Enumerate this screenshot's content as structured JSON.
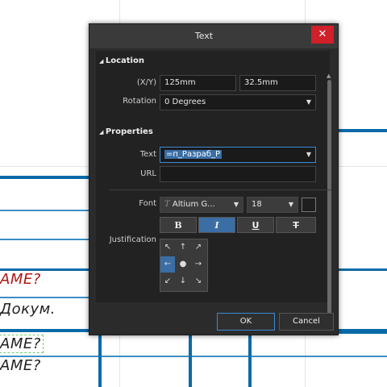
{
  "dialog": {
    "title": "Text",
    "close_icon": "close-icon"
  },
  "location": {
    "heading": "Location",
    "xy_label": "(X/Y)",
    "x_value": "125mm",
    "y_value": "32.5mm",
    "rotation_label": "Rotation",
    "rotation_value": "0 Degrees"
  },
  "properties": {
    "heading": "Properties",
    "text_label": "Text",
    "text_value": "=п_Разраб_Р",
    "url_label": "URL",
    "url_value": "",
    "font_label": "Font",
    "font_name": "Altium G...",
    "font_icon": "font-type-icon",
    "font_size": "18",
    "bold_label": "B",
    "italic_label": "I",
    "underline_label": "U",
    "strike_label": "T",
    "bold_active": false,
    "italic_active": true,
    "justification_label": "Justification",
    "justification_selected": "middle-left"
  },
  "buttons": {
    "ok": "OK",
    "cancel": "Cancel"
  },
  "background_text": {
    "row1": "AME?",
    "row2": "Докум.",
    "row3": "AME?",
    "row4": "AME?"
  },
  "colors": {
    "accent": "#3a6ea5",
    "close": "#d0202a",
    "schematic_line": "#0a6aa8",
    "red_text": "#b01818"
  }
}
